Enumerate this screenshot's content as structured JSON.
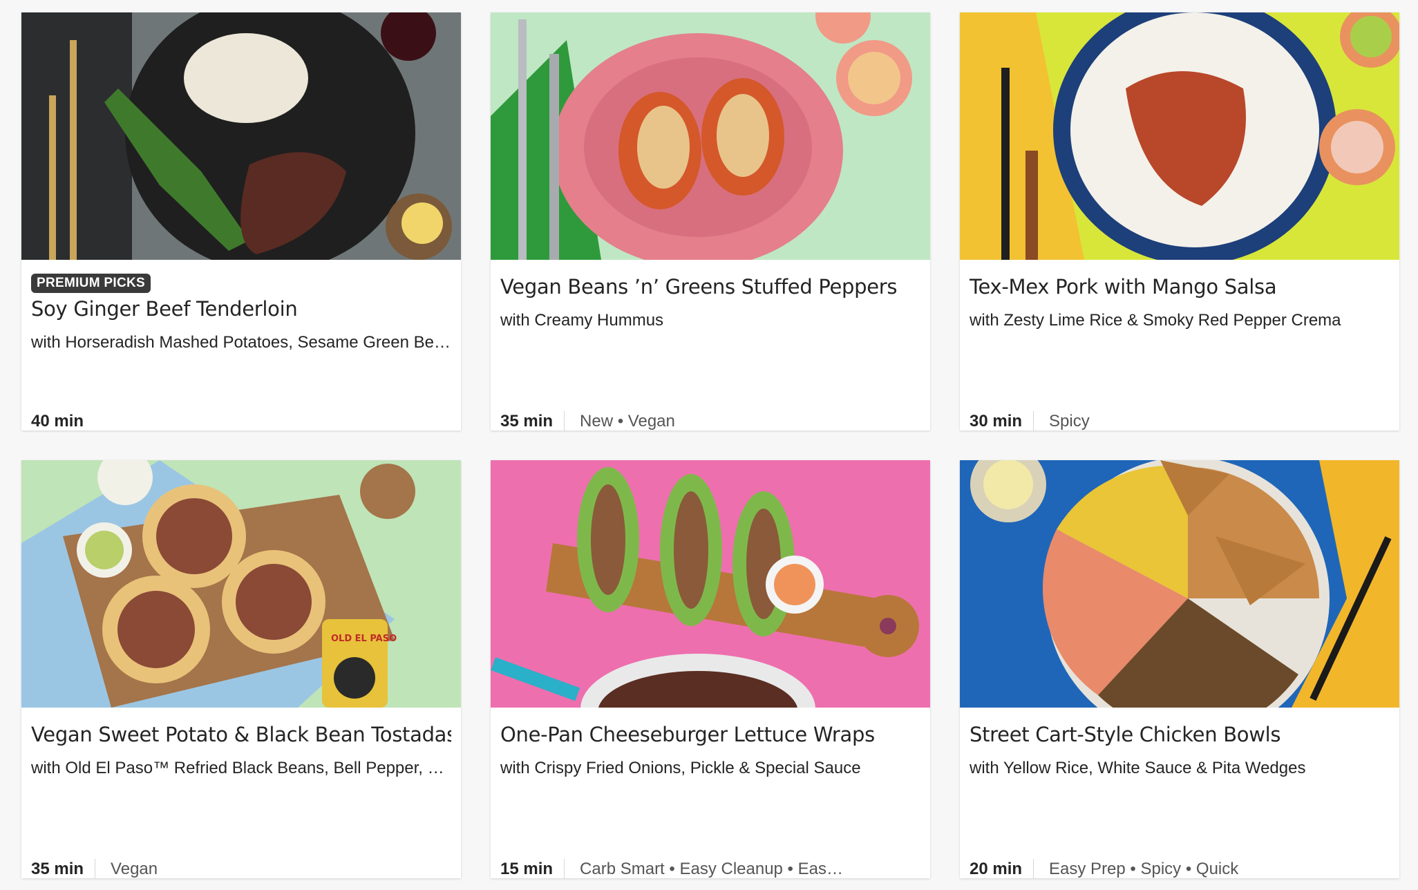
{
  "recipes": [
    {
      "badge": "PREMIUM PICKS",
      "title": "Soy Ginger Beef Tenderloin",
      "subtitle": "with Horseradish Mashed Potatoes, Sesame Green Beans & Soy Ginger Sauce",
      "time": "40 min",
      "tags": ""
    },
    {
      "title": "Vegan Beans ’n’ Greens Stuffed Peppers",
      "subtitle": "with Creamy Hummus",
      "time": "35 min",
      "tags": "New • Vegan"
    },
    {
      "title": "Tex-Mex Pork with Mango Salsa",
      "subtitle": "with Zesty Lime Rice & Smoky Red Pepper Crema",
      "time": "30 min",
      "tags": "Spicy"
    },
    {
      "title": "Vegan Sweet Potato & Black Bean Tostadas",
      "subtitle": "with Old El Paso™ Refried Black Beans, Bell Pepper, Salsa & Guacamole",
      "time": "35 min",
      "tags": "Vegan"
    },
    {
      "title": "One-Pan Cheeseburger Lettuce Wraps",
      "subtitle": "with Crispy Fried Onions, Pickle & Special Sauce",
      "time": "15 min",
      "tags": "Carb Smart • Easy Cleanup • Easy Prep"
    },
    {
      "title": "Street Cart-Style Chicken Bowls",
      "subtitle": "with Yellow Rice, White Sauce & Pita Wedges",
      "time": "20 min",
      "tags": "Easy Prep • Spicy • Quick"
    }
  ],
  "photo_labels": {
    "can_brand": "OLD EL PASO"
  },
  "colors": {
    "badge_bg": "#3a3a3a",
    "photo_backgrounds": [
      "#6f7677",
      "#bfe7c4",
      "#d8e63a",
      "#bfe4b8",
      "#ee6fae",
      "#1f66b8"
    ]
  }
}
